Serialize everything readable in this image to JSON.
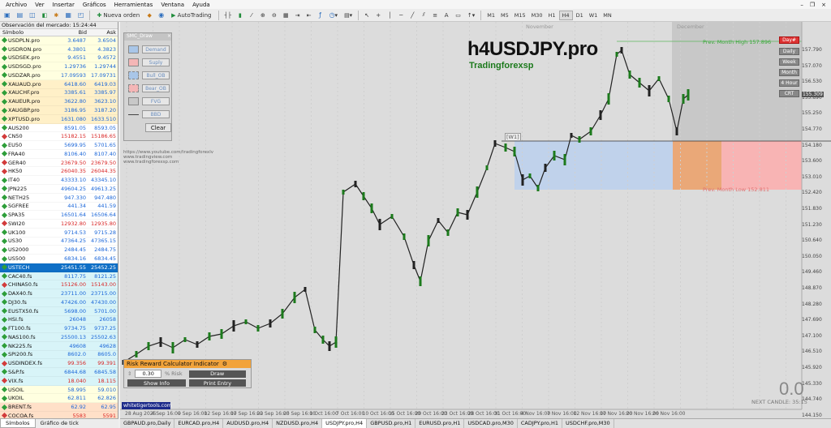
{
  "menu": [
    "Archivo",
    "Ver",
    "Insertar",
    "Gráficos",
    "Herramientas",
    "Ventana",
    "Ayuda"
  ],
  "toolbar": {
    "new_order": "Nueva orden",
    "autotrading": "AutoTrading",
    "timeframes": [
      "M1",
      "M5",
      "M15",
      "M30",
      "H1",
      "H4",
      "D1",
      "W1",
      "MN"
    ],
    "active_timeframe": "H4"
  },
  "market_watch": {
    "title": "Observación del mercado: 15:24:44",
    "columns": [
      "Símbolo",
      "Bid",
      "Ask"
    ],
    "rows": [
      {
        "s": "USDPLN.pro",
        "b": "3.6487",
        "a": "3.6504",
        "c": "#ffffe0",
        "d": "up"
      },
      {
        "s": "USDRON.pro",
        "b": "4.3801",
        "a": "4.3823",
        "c": "#ffffe0",
        "d": "up"
      },
      {
        "s": "USDSEK.pro",
        "b": "9.4551",
        "a": "9.4572",
        "c": "#ffffe0",
        "d": "up"
      },
      {
        "s": "USDSGD.pro",
        "b": "1.29736",
        "a": "1.29744",
        "c": "#ffffe0",
        "d": "up"
      },
      {
        "s": "USDZAR.pro",
        "b": "17.09593",
        "a": "17.09731",
        "c": "#ffffe0",
        "d": "up"
      },
      {
        "s": "XAUAUD.pro",
        "b": "6418.60",
        "a": "6419.03",
        "c": "#fff0c8",
        "d": "up"
      },
      {
        "s": "XAUCHF.pro",
        "b": "3385.61",
        "a": "3385.97",
        "c": "#fff0c8",
        "d": "up"
      },
      {
        "s": "XAUEUR.pro",
        "b": "3622.80",
        "a": "3623.10",
        "c": "#fff0c8",
        "d": "up"
      },
      {
        "s": "XAUGBP.pro",
        "b": "3186.95",
        "a": "3187.20",
        "c": "#fff0c8",
        "d": "up"
      },
      {
        "s": "XPTUSD.pro",
        "b": "1631.080",
        "a": "1633.510",
        "c": "#fff0c8",
        "d": "up"
      },
      {
        "s": "AUS200",
        "b": "8591.05",
        "a": "8593.05",
        "c": "#ffffff",
        "d": "up"
      },
      {
        "s": "CN50",
        "b": "15182.15",
        "a": "15186.65",
        "c": "#ffffff",
        "d": "down"
      },
      {
        "s": "EU50",
        "b": "5699.95",
        "a": "5701.65",
        "c": "#ffffff",
        "d": "up"
      },
      {
        "s": "FRA40",
        "b": "8106.40",
        "a": "8107.40",
        "c": "#ffffff",
        "d": "up"
      },
      {
        "s": "GER40",
        "b": "23679.50",
        "a": "23679.50",
        "c": "#ffffff",
        "d": "down"
      },
      {
        "s": "HK50",
        "b": "26040.35",
        "a": "26044.35",
        "c": "#ffffff",
        "d": "down"
      },
      {
        "s": "IT40",
        "b": "43333.10",
        "a": "43345.10",
        "c": "#ffffff",
        "d": "up"
      },
      {
        "s": "JPN225",
        "b": "49604.25",
        "a": "49613.25",
        "c": "#ffffff",
        "d": "up"
      },
      {
        "s": "NETH25",
        "b": "947.330",
        "a": "947.480",
        "c": "#ffffff",
        "d": "up"
      },
      {
        "s": "SGFREE",
        "b": "441.34",
        "a": "441.59",
        "c": "#ffffff",
        "d": "up"
      },
      {
        "s": "SPA35",
        "b": "16501.64",
        "a": "16506.64",
        "c": "#ffffff",
        "d": "up"
      },
      {
        "s": "SWI20",
        "b": "12932.80",
        "a": "12935.80",
        "c": "#ffffff",
        "d": "down"
      },
      {
        "s": "UK100",
        "b": "9714.53",
        "a": "9715.28",
        "c": "#ffffff",
        "d": "up"
      },
      {
        "s": "US30",
        "b": "47364.25",
        "a": "47365.15",
        "c": "#ffffff",
        "d": "up"
      },
      {
        "s": "US2000",
        "b": "2484.45",
        "a": "2484.75",
        "c": "#ffffff",
        "d": "up"
      },
      {
        "s": "US500",
        "b": "6834.16",
        "a": "6834.45",
        "c": "#ffffff",
        "d": "up"
      },
      {
        "s": "USTECH",
        "b": "25451.55",
        "a": "25452.25",
        "c": "#0f6fc6",
        "d": "up",
        "sel": true
      },
      {
        "s": "CAC40.fs",
        "b": "8117.75",
        "a": "8121.25",
        "c": "#d8f4f8",
        "d": "up"
      },
      {
        "s": "CHINA50.fs",
        "b": "15126.00",
        "a": "15143.00",
        "c": "#d8f4f8",
        "d": "down"
      },
      {
        "s": "DAX40.fs",
        "b": "23711.00",
        "a": "23715.00",
        "c": "#d8f4f8",
        "d": "up"
      },
      {
        "s": "DJ30.fs",
        "b": "47426.00",
        "a": "47430.00",
        "c": "#d8f4f8",
        "d": "up"
      },
      {
        "s": "EUSTX50.fs",
        "b": "5698.00",
        "a": "5701.00",
        "c": "#d8f4f8",
        "d": "up"
      },
      {
        "s": "HSI.fs",
        "b": "26048",
        "a": "26058",
        "c": "#d8f4f8",
        "d": "up"
      },
      {
        "s": "FT100.fs",
        "b": "9734.75",
        "a": "9737.25",
        "c": "#d8f4f8",
        "d": "up"
      },
      {
        "s": "NAS100.fs",
        "b": "25500.13",
        "a": "25502.63",
        "c": "#d8f4f8",
        "d": "up"
      },
      {
        "s": "NK225.fs",
        "b": "49608",
        "a": "49628",
        "c": "#d8f4f8",
        "d": "up"
      },
      {
        "s": "SPI200.fs",
        "b": "8602.0",
        "a": "8605.0",
        "c": "#d8f4f8",
        "d": "up"
      },
      {
        "s": "USDINDEX.fs",
        "b": "99.356",
        "a": "99.391",
        "c": "#d8f4f8",
        "d": "down"
      },
      {
        "s": "S&P.fs",
        "b": "6844.68",
        "a": "6845.58",
        "c": "#d8f4f8",
        "d": "up"
      },
      {
        "s": "VIX.fs",
        "b": "18.040",
        "a": "18.115",
        "c": "#d8f4f8",
        "d": "down"
      },
      {
        "s": "USOIL",
        "b": "58.995",
        "a": "59.010",
        "c": "#ffffe0",
        "d": "up"
      },
      {
        "s": "UKOIL",
        "b": "62.811",
        "a": "62.826",
        "c": "#ffffe0",
        "d": "up"
      },
      {
        "s": "BRENT.fs",
        "b": "62.92",
        "a": "62.95",
        "c": "#ffe0c8",
        "d": "up"
      },
      {
        "s": "COCOA.fs",
        "b": "5583",
        "a": "5591",
        "c": "#ffe0c8",
        "d": "down"
      }
    ],
    "tabs": [
      "Símbolos",
      "Gráfico de tick"
    ]
  },
  "chart": {
    "title": "h4USDJPY.pro",
    "subtitle": "Tradingforexsp",
    "prev_month_high": "Prev. Month High 157.896",
    "prev_month_low": "Prev. Month Low 152.811",
    "w1_label": "[W1]",
    "month_labels": [
      "November",
      "December"
    ],
    "links": [
      "https://www.youtube.com/tradingforexlv",
      "www.tradingview.com",
      "www.tradingforexsp.com"
    ],
    "price_ticks": [
      "157.790",
      "157.070",
      "156.530",
      "155.890",
      "155.250",
      "154.770",
      "154.180",
      "153.600",
      "153.010",
      "152.420",
      "151.830",
      "151.230",
      "150.640",
      "150.050",
      "149.460",
      "148.870",
      "148.280",
      "147.690",
      "147.100",
      "146.510",
      "145.920",
      "145.330",
      "144.740",
      "144.150"
    ],
    "time_ticks": [
      "28 Aug 2025",
      "4 Sep 16:00",
      "9 Sep 16:00",
      "12 Sep 16:00",
      "17 Sep 16:00",
      "22 Sep 16:00",
      "25 Sep 16:00",
      "1 Oct 16:00",
      "7 Oct 16:00",
      "10 Oct 16:00",
      "15 Oct 16:00",
      "20 Oct 16:00",
      "23 Oct 16:00",
      "28 Oct 16:00",
      "31 Oct 16:00",
      "4 Nov 16:00",
      "7 Nov 16:00",
      "12 Nov 16:00",
      "17 Nov 16:00",
      "20 Nov 16:00",
      "26 Nov 16:00"
    ],
    "last_price": "155.309",
    "tf_buttons": [
      "Day#",
      "Daily",
      "Week",
      "Month",
      "4 Hour",
      "CRT"
    ],
    "big_number": "0.0",
    "next_candle": "NEXT CANDLE: 35:15"
  },
  "draw_panel": {
    "title": "SMC_Draw",
    "buttons": [
      "Demand",
      "Suply",
      "Bull_OB",
      "Bear_OB",
      "FVG",
      "BBD"
    ],
    "clear": "Clear"
  },
  "risk_reward": {
    "title": "Risk Reward Calculator Indicator",
    "risk_value": "0.30",
    "risk_label": "% Risk",
    "draw": "Draw",
    "show_info": "Show Info",
    "print_entry": "Print Entry"
  },
  "whitetiger": "whitetigertools.com",
  "chart_tabs": [
    "GBPAUD.pro,Daily",
    "EURCAD.pro,H4",
    "AUDUSD.pro,H4",
    "NZDUSD.pro,H4",
    "USDJPY.pro,H4",
    "GBPUSD.pro,H1",
    "EURUSD.pro,H1",
    "USDCAD.pro,M30",
    "CADJPY.pro,H1",
    "USDCHF.pro,M30"
  ],
  "active_chart_tab": "USDJPY.pro,H4"
}
